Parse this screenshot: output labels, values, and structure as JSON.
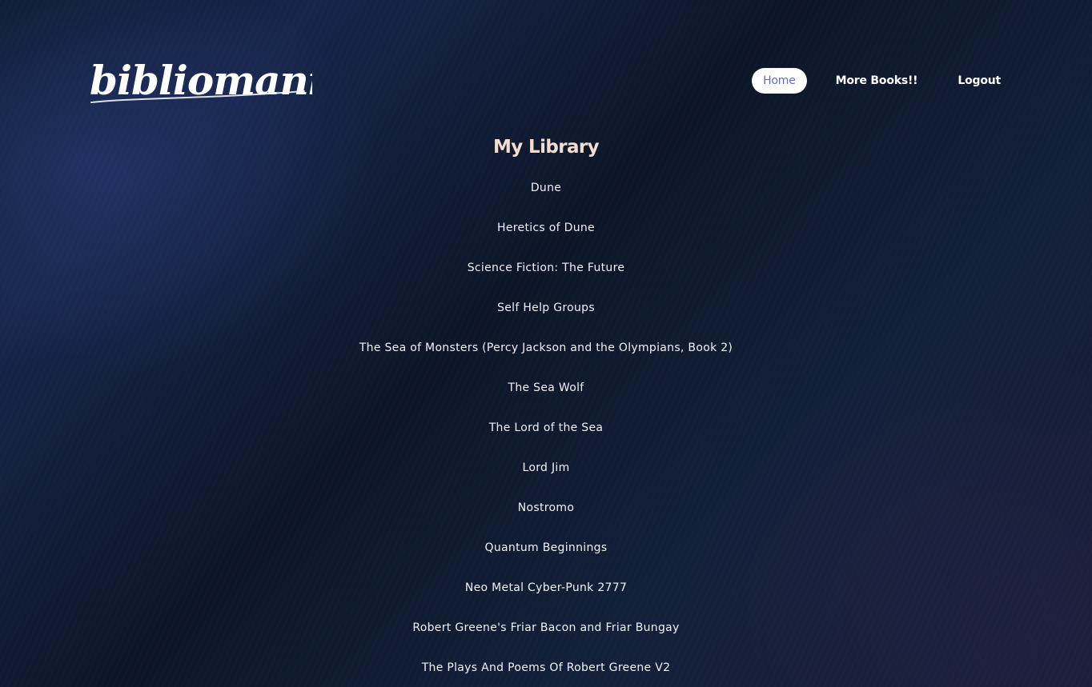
{
  "brand": {
    "logo_text": "bibliomania"
  },
  "nav": {
    "items": [
      {
        "label": "Home",
        "active": true
      },
      {
        "label": "More Books!!",
        "active": false
      },
      {
        "label": "Logout",
        "active": false
      }
    ]
  },
  "main": {
    "title": "My Library",
    "books": [
      "Dune",
      "Heretics of Dune",
      "Science Fiction: The Future",
      "Self Help Groups",
      "The Sea of Monsters (Percy Jackson and the Olympians, Book 2)",
      "The Sea Wolf",
      "The Lord of the Sea",
      "Lord Jim",
      "Nostromo",
      "Quantum Beginnings",
      "Neo Metal Cyber-Punk 2777",
      "Robert Greene's Friar Bacon and Friar Bungay",
      "The Plays And Poems Of Robert Greene V2"
    ]
  },
  "colors": {
    "title": "#f3ddd0",
    "active_nav_text": "#5a6bd6",
    "active_nav_bg": "#ffffff",
    "text": "#f1f2f7"
  }
}
